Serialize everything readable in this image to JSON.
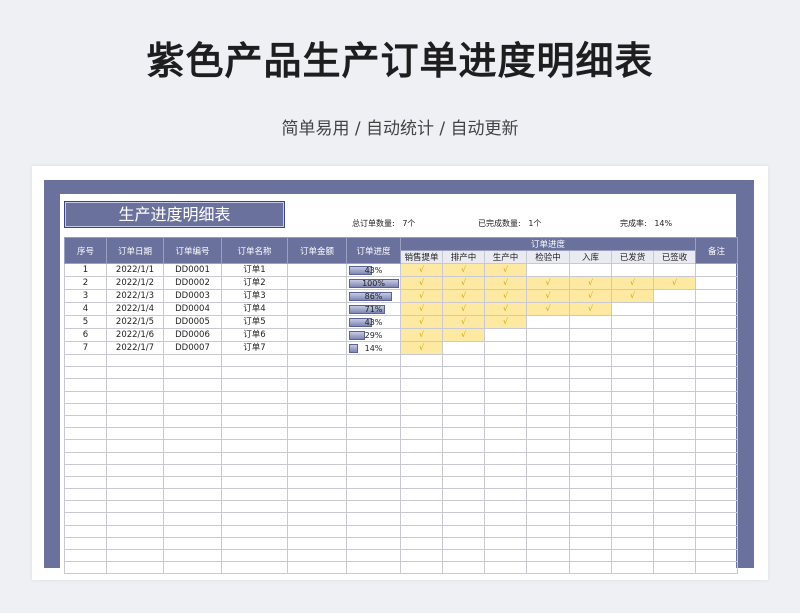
{
  "title": "紫色产品生产订单进度明细表",
  "subtitle": "简单易用 / 自动统计 / 自动更新",
  "sheet": {
    "header_title": "生产进度明细表",
    "stats": [
      {
        "label": "总订单数量:",
        "value": "7个"
      },
      {
        "label": "已完成数量:",
        "value": "1个"
      },
      {
        "label": "完成率:",
        "value": "14%"
      }
    ]
  },
  "table": {
    "columns": [
      "序号",
      "订单日期",
      "订单编号",
      "订单名称",
      "订单金额",
      "订单进度"
    ],
    "stage_group": "订单进度",
    "stages": [
      "销售提单",
      "排产中",
      "生产中",
      "检验中",
      "入库",
      "已发货",
      "已签收"
    ],
    "remark": "备注",
    "check_mark": "√",
    "rows": [
      {
        "seq": "1",
        "date": "2022/1/1",
        "code": "DD0001",
        "name": "订单1",
        "amount": "",
        "progress": "43%",
        "pct": 43,
        "steps": 3
      },
      {
        "seq": "2",
        "date": "2022/1/2",
        "code": "DD0002",
        "name": "订单2",
        "amount": "",
        "progress": "100%",
        "pct": 100,
        "steps": 7
      },
      {
        "seq": "3",
        "date": "2022/1/3",
        "code": "DD0003",
        "name": "订单3",
        "amount": "",
        "progress": "86%",
        "pct": 86,
        "steps": 6
      },
      {
        "seq": "4",
        "date": "2022/1/4",
        "code": "DD0004",
        "name": "订单4",
        "amount": "",
        "progress": "71%",
        "pct": 71,
        "steps": 5
      },
      {
        "seq": "5",
        "date": "2022/1/5",
        "code": "DD0005",
        "name": "订单5",
        "amount": "",
        "progress": "43%",
        "pct": 43,
        "steps": 3
      },
      {
        "seq": "6",
        "date": "2022/1/6",
        "code": "DD0006",
        "name": "订单6",
        "amount": "",
        "progress": "29%",
        "pct": 29,
        "steps": 2
      },
      {
        "seq": "7",
        "date": "2022/1/7",
        "code": "DD0007",
        "name": "订单7",
        "amount": "",
        "progress": "14%",
        "pct": 14,
        "steps": 1
      }
    ],
    "empty_rows": 18
  },
  "colors": {
    "accent": "#6a719c",
    "done": "#fde9a1",
    "check": "#d4a000"
  }
}
